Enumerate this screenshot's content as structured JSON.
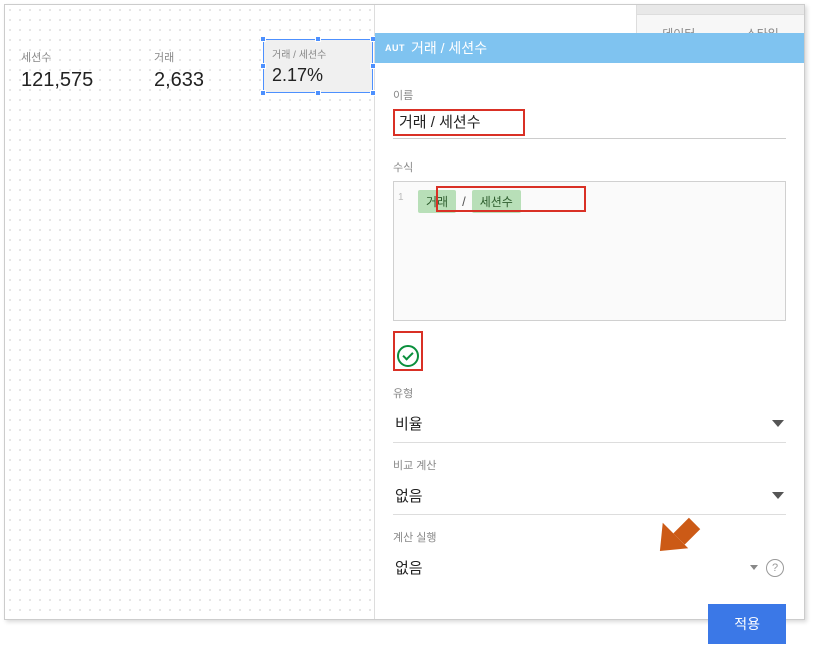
{
  "canvas": {
    "metrics": [
      {
        "label": "세션수",
        "value": "121,575"
      },
      {
        "label": "거래",
        "value": "2,633"
      },
      {
        "label": "거래 / 세션수",
        "value": "2.17%"
      }
    ]
  },
  "sidebar": {
    "tabs": [
      {
        "label": "데이터"
      },
      {
        "label": "스타일"
      }
    ]
  },
  "panel": {
    "badge": "AUT",
    "title": "거래 / 세션수",
    "name_label": "이름",
    "name_value": "거래 / 세션수",
    "formula_label": "수식",
    "formula": {
      "chip1": "거래",
      "operator": "/",
      "chip2": "세션수"
    },
    "type_label": "유형",
    "type_value": "비율",
    "compare_label": "비교 계산",
    "compare_value": "없음",
    "running_label": "계산 실행",
    "running_value": "없음",
    "apply_label": "적용"
  }
}
